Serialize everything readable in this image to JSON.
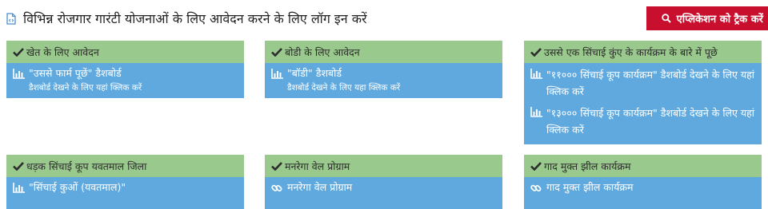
{
  "header": {
    "title": "विभिन्न रोजगार गारंटी योजनाओं के लिए आवेदन करने के लिए लॉग इन करें",
    "track_button_label": "एप्लिकेशन को ट्रैक करें"
  },
  "colors": {
    "accent_red": "#c8102e",
    "panel_header": "#99c98c",
    "panel_body": "#5fa9df"
  },
  "panels": [
    {
      "heading": "खेत के लिए आवेदन",
      "items": [
        {
          "icon": "bar-chart-icon",
          "title": "\"उससे फार्म पूछें\" डैशबोर्ड",
          "subtitle": "डैशबोर्ड देखने के लिए यहां क्लिक करें"
        }
      ]
    },
    {
      "heading": "बोडी के लिए आवेदन",
      "items": [
        {
          "icon": "bar-chart-icon",
          "title": "\"बॉडी\" डैशबोर्ड",
          "subtitle": "डैशबोर्ड देखने के लिए यहा क्लिक करें"
        }
      ]
    },
    {
      "heading": "उससे एक सिंचाई कुंए के कार्यक्रम के बारे में पूछे",
      "items": [
        {
          "icon": "bar-chart-icon",
          "title": "\"११००० सिंचाई कूप कार्यक्रम\" डैशबोर्ड देखने के लिए यहां क्लिक करें"
        },
        {
          "icon": "bar-chart-icon",
          "title": "\"१३००० सिंचाई कूप कार्यक्रम\" डैशबोर्ड देखने के लिए यहां क्लिक करें"
        }
      ]
    },
    {
      "heading": "धड़क सिंचाई कूप यवतमाल जिला",
      "items": [
        {
          "icon": "bar-chart-icon",
          "title": "\"सिंचाई कुओं (यवतमाल)\""
        }
      ]
    },
    {
      "heading": "मनरेगा वेल प्रोग्राम",
      "items": [
        {
          "icon": "link-icon",
          "title": "मनरेगा वेल प्रोग्राम"
        }
      ]
    },
    {
      "heading": "गाद मुक्त झील कार्यक्रम",
      "items": [
        {
          "icon": "link-icon",
          "title": "गाद मुक्त झील कार्यक्रम"
        }
      ]
    }
  ]
}
